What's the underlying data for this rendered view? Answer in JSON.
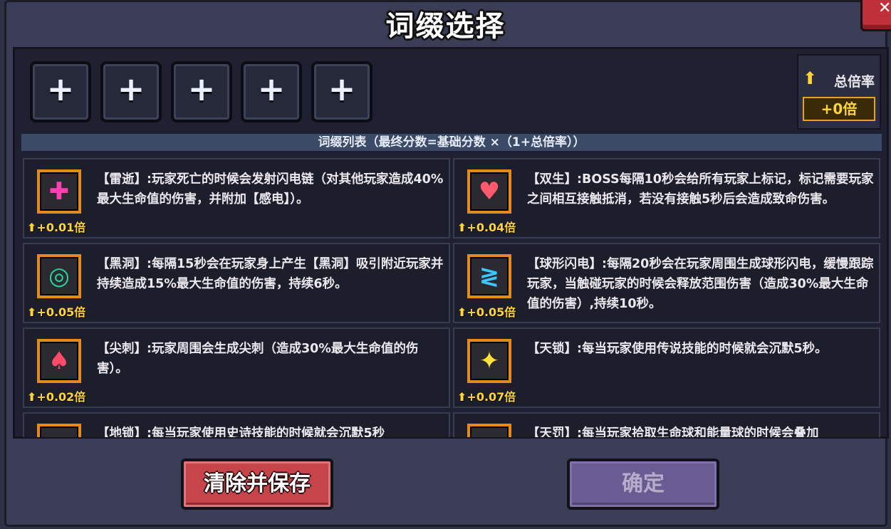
{
  "window": {
    "title": "词缀选择",
    "close_icon": "close-icon"
  },
  "slots": [
    "+",
    "+",
    "+",
    "+",
    "+"
  ],
  "total_rate": {
    "label": "总倍率",
    "value": "+0倍",
    "icon": "arrow-up-icon"
  },
  "list_header": "词缀列表（最终分数=基础分数 ×（1+总倍率））",
  "affixes": [
    {
      "name": "雷逝",
      "desc": "【雷逝】:玩家死亡的时候会发射闪电链（对其他玩家造成40%最大生命值的伤害，并附加【感电】）。",
      "mult": "+0.01倍",
      "icon": "lightning-cross-icon",
      "icon_color": "#ff3fb4"
    },
    {
      "name": "双生",
      "desc": "【双生】:BOSS每隔10秒会给所有玩家上标记，标记需要玩家之间相互接触抵消，若没有接触5秒后会造成致命伤害。",
      "mult": "+0.04倍",
      "icon": "split-heart-icon",
      "icon_color": "#ff5a6e"
    },
    {
      "name": "黑洞",
      "desc": "【黑洞】:每隔15秒会在玩家身上产生【黑洞】吸引附近玩家并持续造成15%最大生命值的伤害，持续6秒。",
      "mult": "+0.05倍",
      "icon": "black-hole-icon",
      "icon_color": "#29d39a"
    },
    {
      "name": "球形闪电",
      "desc": "【球形闪电】:每隔20秒会在玩家周围生成球形闪电，缓慢跟踪玩家，当触碰玩家的时候会释放范围伤害（造成30%最大生命值的伤害）,持续10秒。",
      "mult": "+0.05倍",
      "icon": "ball-lightning-icon",
      "icon_color": "#3fc4ff"
    },
    {
      "name": "尖刺",
      "desc": "【尖刺】:玩家周围会生成尖刺（造成30%最大生命值的伤害）。",
      "mult": "+0.02倍",
      "icon": "spike-icon",
      "icon_color": "#ff4a6a"
    },
    {
      "name": "天锁",
      "desc": "【天锁】:每当玩家使用传说技能的时候就会沉默5秒。",
      "mult": "+0.07倍",
      "icon": "sparkle-lock-icon",
      "icon_color": "#ffe23a"
    },
    {
      "name": "地锁",
      "desc": "【地锁】:每当玩家使用史诗技能的时候就会沉默5秒",
      "mult": "",
      "icon": "earth-lock-icon",
      "icon_color": "#d23ad8"
    },
    {
      "name": "天罚",
      "desc": "【天罚】:每当玩家拾取生命球和能量球的时候会叠加",
      "mult": "",
      "icon": "heaven-punish-icon",
      "icon_color": "#c8b060"
    }
  ],
  "buttons": {
    "clear_save": "清除并保存",
    "confirm": "确定"
  }
}
